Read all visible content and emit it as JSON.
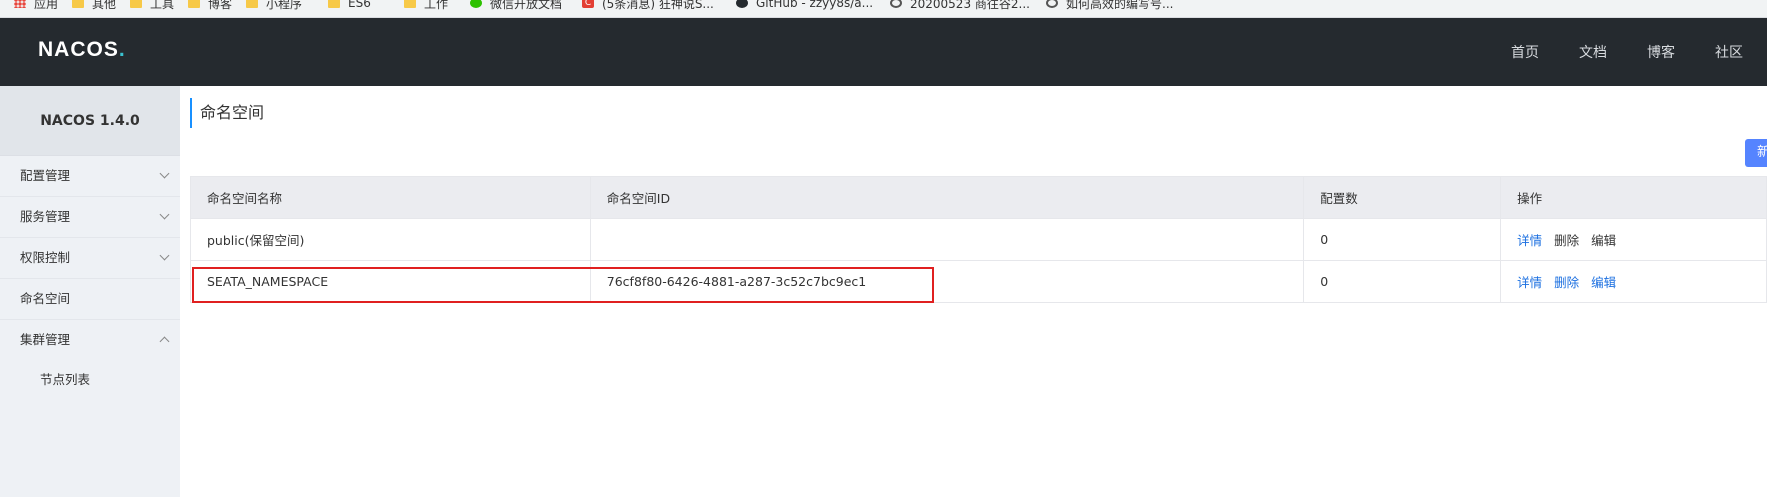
{
  "bookmarks": [
    {
      "label": "应用",
      "icon": "apps-icon"
    },
    {
      "label": "其他",
      "icon": "folder-icon"
    },
    {
      "label": "工具",
      "icon": "folder-icon"
    },
    {
      "label": "博客",
      "icon": "folder-icon"
    },
    {
      "label": "小程序",
      "icon": "folder-icon"
    },
    {
      "label": "ES6",
      "icon": "folder-icon"
    },
    {
      "label": "工作",
      "icon": "folder-icon"
    },
    {
      "label": "微信开放文档",
      "icon": "wechat-icon"
    },
    {
      "label": "(5条消息) 狂神说S...",
      "icon": "csdn-icon"
    },
    {
      "label": "GitHub - zzyy8s/a...",
      "icon": "github-icon"
    },
    {
      "label": "20200523 商往谷2...",
      "icon": "q-icon"
    },
    {
      "label": "如何高效的编写号...",
      "icon": "q-icon"
    }
  ],
  "header": {
    "logo": "NACOS",
    "logo_dot": ".",
    "nav": [
      "首页",
      "文档",
      "博客",
      "社区"
    ]
  },
  "sidebar": {
    "version": "NACOS 1.4.0",
    "items": [
      {
        "label": "配置管理"
      },
      {
        "label": "服务管理"
      },
      {
        "label": "权限控制"
      },
      {
        "label": "命名空间"
      },
      {
        "label": "集群管理"
      },
      {
        "label": "节点列表"
      }
    ]
  },
  "main": {
    "title": "命名空间",
    "new_button": "新",
    "table": {
      "headers": [
        "命名空间名称",
        "命名空间ID",
        "配置数",
        "操作"
      ],
      "rows": [
        {
          "name": "public(保留空间)",
          "id": "",
          "count": "0",
          "ops": [
            "详情",
            "删除",
            "编辑"
          ]
        },
        {
          "name": "SEATA_NAMESPACE",
          "id": "76cf8f80-6426-4881-a287-3c52c7bc9ec1",
          "count": "0",
          "ops": [
            "详情",
            "删除",
            "编辑"
          ]
        }
      ]
    }
  },
  "colors": {
    "header_bg": "#252a2f",
    "accent": "#1b6fe0",
    "highlight": "#e02020",
    "button": "#5584ff"
  }
}
